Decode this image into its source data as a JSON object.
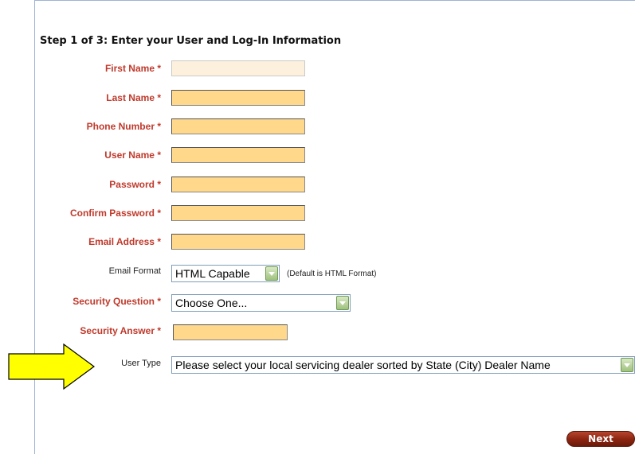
{
  "step_heading": "Step 1 of 3: Enter your User and Log-In Information",
  "fields": [
    {
      "label": "First Name *",
      "value": ""
    },
    {
      "label": "Last Name *",
      "value": ""
    },
    {
      "label": "Phone Number *",
      "value": ""
    },
    {
      "label": "User Name *",
      "value": ""
    },
    {
      "label": "Password *",
      "value": ""
    },
    {
      "label": "Confirm Password *",
      "value": ""
    },
    {
      "label": "Email Address *",
      "value": ""
    }
  ],
  "email_format": {
    "label": "Email Format",
    "selected": "HTML Capable",
    "hint": "(Default is HTML Format)"
  },
  "security_question": {
    "label": "Security Question *",
    "selected": "Choose One..."
  },
  "security_answer": {
    "label": "Security Answer *",
    "value": ""
  },
  "user_type": {
    "label": "User Type",
    "selected": "Please select your local servicing dealer sorted by State (City) Dealer Name"
  },
  "next_label": "Next",
  "colors": {
    "label_required": "#c0392b",
    "field_fill": "#ffd88c",
    "annotation_arrow": "#ffff00",
    "next_button": "#8a2410"
  }
}
